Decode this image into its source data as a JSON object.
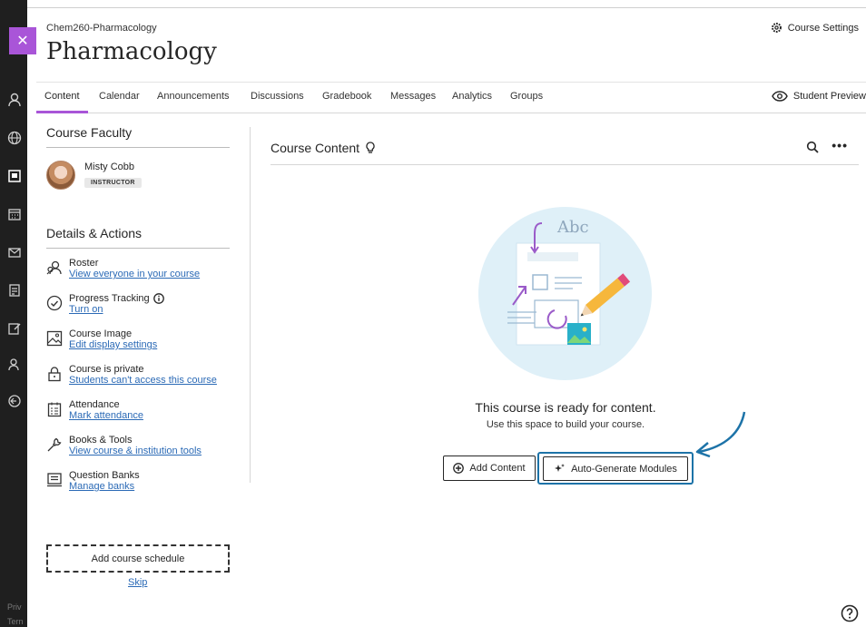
{
  "header": {
    "course_code": "Chem260-Pharmacology",
    "course_title": "Pharmacology",
    "settings_label": "Course Settings"
  },
  "nav": {
    "tabs": [
      {
        "label": "Content",
        "active": true
      },
      {
        "label": "Calendar"
      },
      {
        "label": "Announcements"
      },
      {
        "label": "Discussions"
      },
      {
        "label": "Gradebook"
      },
      {
        "label": "Messages"
      },
      {
        "label": "Analytics"
      },
      {
        "label": "Groups"
      }
    ],
    "student_preview": "Student Preview"
  },
  "faculty": {
    "title": "Course Faculty",
    "name": "Misty Cobb",
    "role": "INSTRUCTOR"
  },
  "details": {
    "title": "Details & Actions",
    "actions": [
      {
        "title": "Roster",
        "link": "View everyone in your course",
        "icon": "roster-icon"
      },
      {
        "title": "Progress Tracking",
        "link": "Turn on",
        "icon": "progress-check-icon"
      },
      {
        "title": "Course Image",
        "link": "Edit display settings",
        "icon": "image-icon"
      },
      {
        "title": "Course is private",
        "link": "Students can't access this course",
        "icon": "lock-icon"
      },
      {
        "title": "Attendance",
        "link": "Mark attendance",
        "icon": "attendance-icon"
      },
      {
        "title": "Books & Tools",
        "link": "View course & institution tools",
        "icon": "wrench-icon"
      },
      {
        "title": "Question Banks",
        "link": "Manage banks",
        "icon": "question-bank-icon"
      }
    ],
    "schedule_button": "Add course schedule",
    "skip_link": "Skip"
  },
  "content": {
    "title": "Course Content",
    "illustration_text": "Abc",
    "empty_title": "This course is ready for content.",
    "empty_subtitle": "Use this space to build your course.",
    "add_button": "Add Content",
    "auto_button": "Auto-Generate Modules"
  },
  "rail": {
    "footer_1": "Priv",
    "footer_2": "Tern"
  },
  "colors": {
    "accent_purple": "#a955d8",
    "link_blue": "#2b6ab6",
    "highlight_blue": "#1d73a8",
    "rail_dark": "#1f1f1f"
  }
}
